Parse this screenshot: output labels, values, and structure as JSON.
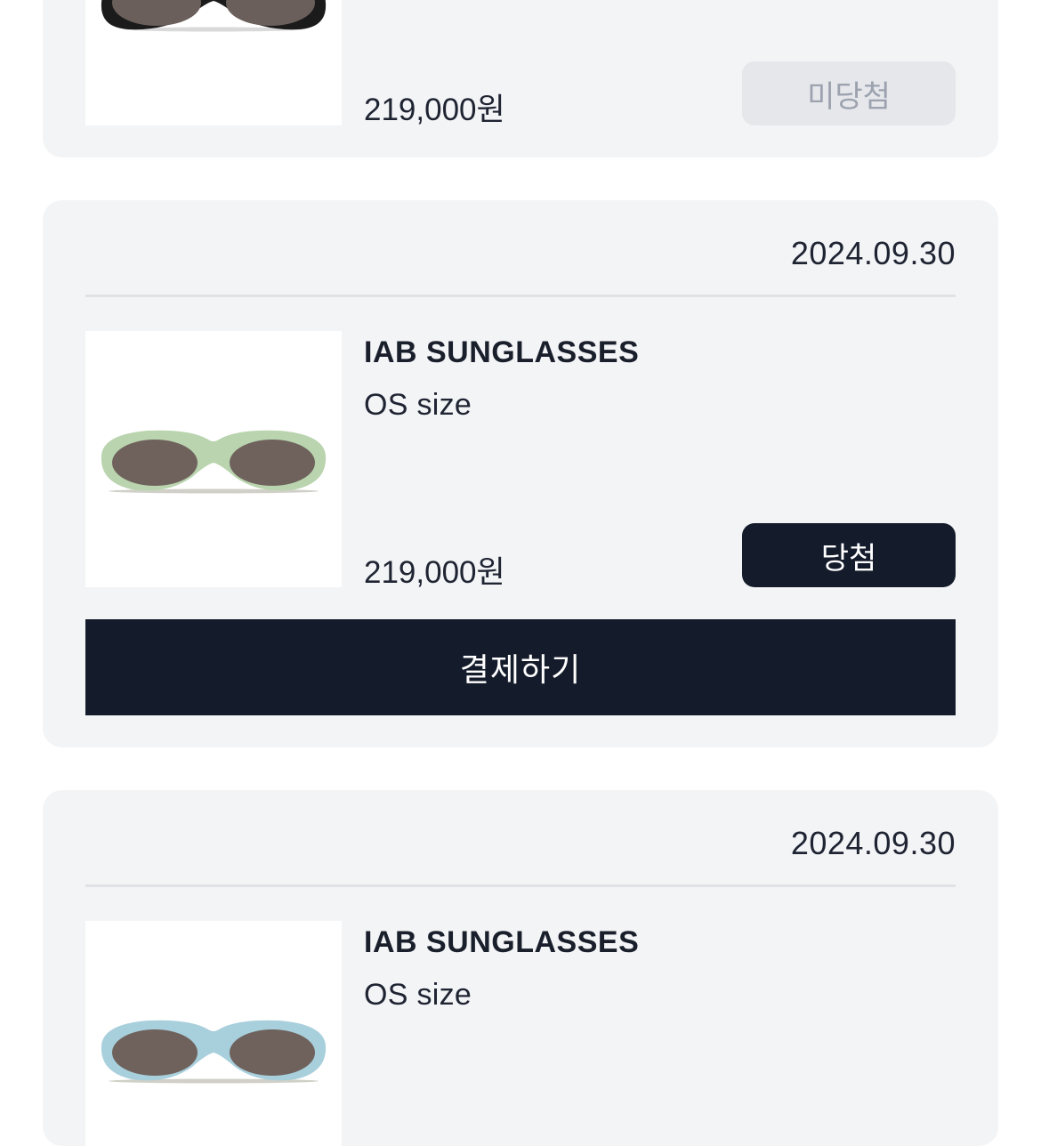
{
  "colors": {
    "card_bg": "#f3f4f6",
    "dark_button": "#141b2b",
    "disabled_button": "#e5e7eb",
    "disabled_text": "#9ca3af"
  },
  "orders": [
    {
      "price": "219,000원",
      "status_label": "미당첨",
      "frame_color": "black"
    },
    {
      "date": "2024.09.30",
      "product_name": "IAB SUNGLASSES",
      "option": "OS size",
      "price": "219,000원",
      "status_label": "당첨",
      "pay_label": "결제하기",
      "frame_color": "mint green"
    },
    {
      "date": "2024.09.30",
      "product_name": "IAB SUNGLASSES",
      "option": "OS size",
      "frame_color": "light blue"
    }
  ]
}
